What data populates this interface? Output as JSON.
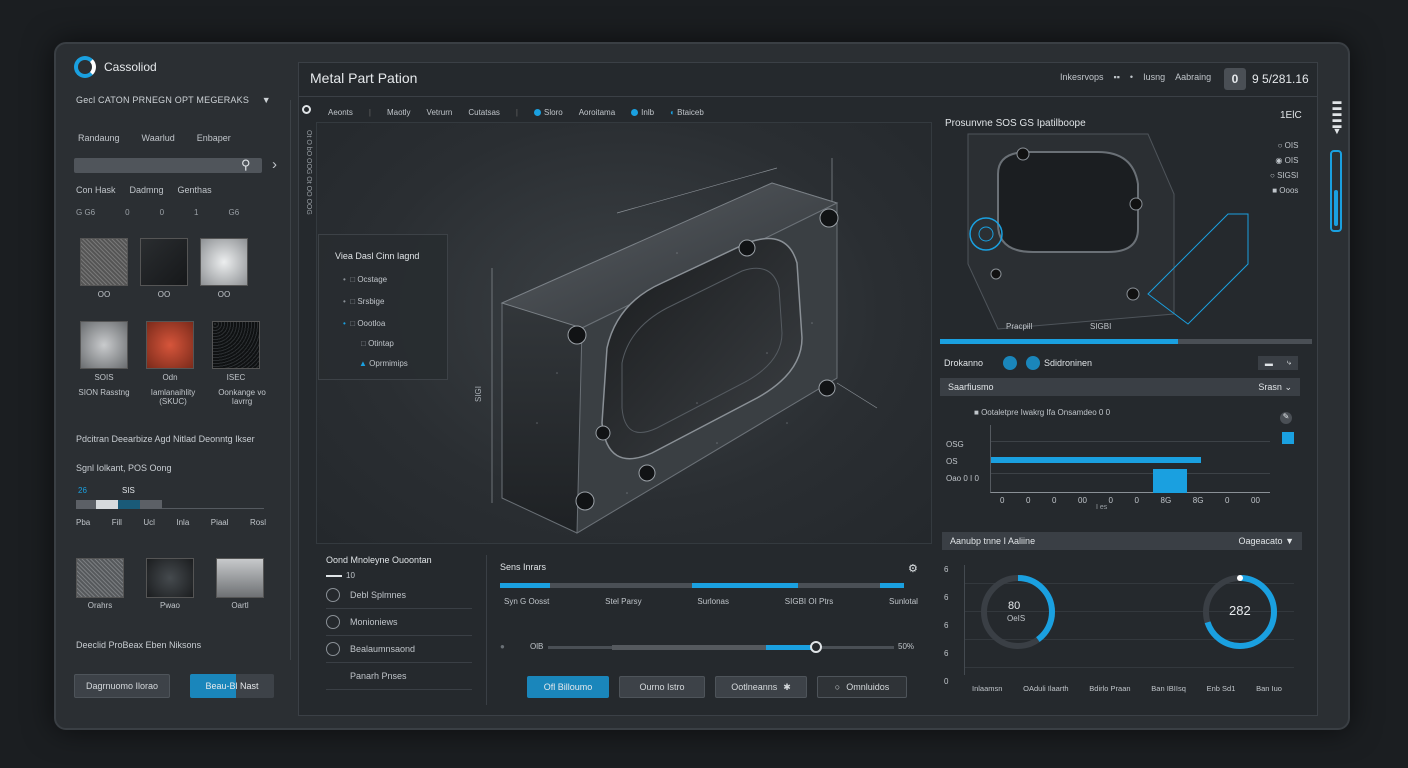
{
  "app": {
    "name": "Cassoliod",
    "window_title": "Metal Part Pation"
  },
  "header": {
    "right_items": [
      "Inkesrvops",
      "▪▪",
      "•",
      "Iusng",
      "Aabraing"
    ],
    "clock": "9 5/281.16",
    "clock_icon": "0"
  },
  "sidebar": {
    "title": "Gecl CATON PRNEGN OPT MEGERAKS",
    "tabs": [
      "Randaung",
      "Waarlud",
      "Enbaper"
    ],
    "filters": [
      "Con Hask",
      "Dadmng",
      "Genthas"
    ],
    "counts": [
      "G G6",
      "0",
      "0",
      "1",
      "G6"
    ],
    "materials": [
      {
        "label": "OO",
        "color": "#6a6d70"
      },
      {
        "label": "OO",
        "color": "#1f2225"
      },
      {
        "label": "OO",
        "color": "#c9cbcd"
      },
      {
        "label": "SOIS",
        "color": "#a3a6a9"
      },
      {
        "label": "Odn",
        "color": "#c24a33"
      },
      {
        "label": "ISEC",
        "color": "#141618"
      }
    ],
    "material_names": [
      "SION Rasstng",
      "Iamlanaihlity (SKUC)",
      "Oonkange vo Iavrrg"
    ],
    "section1": "Pdcitran Deearbize Agd Nitlad Deonntg Ikser",
    "section2": "Sgnl Iolkant, POS Oong",
    "bar_labels_top": [
      "26",
      "SIS"
    ],
    "bar_labels": [
      "Pba",
      "Fill",
      "Ucl",
      "Inla",
      "Piaal",
      "Rosl"
    ],
    "finishes": [
      {
        "label": "Orahrs",
        "color": "#6c6f72"
      },
      {
        "label": "Pwao",
        "color": "#2a2d30"
      },
      {
        "label": "Oartl",
        "color": "#9ea1a4"
      }
    ],
    "section3": "Deeclid ProBeax Eben Niksons",
    "btn_left": "Dagrnuomo Ilorao",
    "btn_right": "Beau-Bl Nast"
  },
  "toolbar": {
    "items": [
      "Aeonts",
      "Maotly",
      "Vetrurn",
      "Cutatsas",
      "Sloro",
      "Aoroitama",
      "Inlb",
      "Btaiceb"
    ]
  },
  "viewport": {
    "popup_title": "Viea Dasl Cinn Iagnd",
    "popup_items": [
      "Ocstage",
      "Srsbige",
      "Oootloa",
      "Otintap",
      "Oprmimips"
    ],
    "dim_label": "SIGI"
  },
  "bottom": {
    "list_title": "Oond Mnoleyne Ouoontan",
    "list_sub": "10",
    "list_items": [
      "Debl Splmnes",
      "Monioniews",
      "Bealaumnsaond",
      "Panarh Pnses"
    ],
    "process_title": "Sens Inrars",
    "process_steps": [
      "Syn G Oosst",
      "Stel Parsy",
      "Surlonas",
      "SIGBI OI Ptrs",
      "Sunlotal"
    ],
    "progress_percent": 0.4,
    "slider_left": "OlB",
    "slider_right": "50%",
    "buttons": [
      "Ofl Billoumo",
      "Ourno Istro",
      "Ootlneanns",
      "Omnluidos"
    ]
  },
  "preview": {
    "title": "Prosunvne SOS GS Ipatilboope",
    "value": "1ElC",
    "side_items": [
      "OIS",
      "OIS",
      "SIGSI",
      "Ooos"
    ],
    "foot_left": "Pracpill",
    "foot_right": "SIGBI"
  },
  "analysis": {
    "label_left": "Drokanno",
    "label_right": "Sdidroninen",
    "dropdown_label": "Saarfiusmo",
    "dropdown_value": "Srasn",
    "graph_legend": "Ootaletpre Iwakrg Ifa Onsamdeo 0 0",
    "graph_rows": [
      "OSG",
      "OS",
      "Oao 0 I 0"
    ],
    "graph_x": [
      "0",
      "0",
      "0",
      "00",
      "0",
      "0",
      "8G",
      "8G",
      "0",
      "00"
    ],
    "graph_xlabel": "I es"
  },
  "gauges": {
    "header": "Aanubp tnne I Aaliine",
    "header_value": "Oageacato",
    "left_value": "80",
    "left_sub": "OeIS",
    "left_percent": 0.4,
    "right_value": "282",
    "right_percent": 0.7,
    "y_ticks": [
      "6",
      "6",
      "6",
      "6",
      "0"
    ],
    "footer": [
      "Inlaamsn",
      "OAduli Ilaarth",
      "Bdirlo Praan",
      "Ban IBIIsq",
      "Enb Sd1",
      "Ban Iuo"
    ]
  },
  "colors": {
    "accent": "#1aa0e0",
    "panel": "#25292d"
  }
}
